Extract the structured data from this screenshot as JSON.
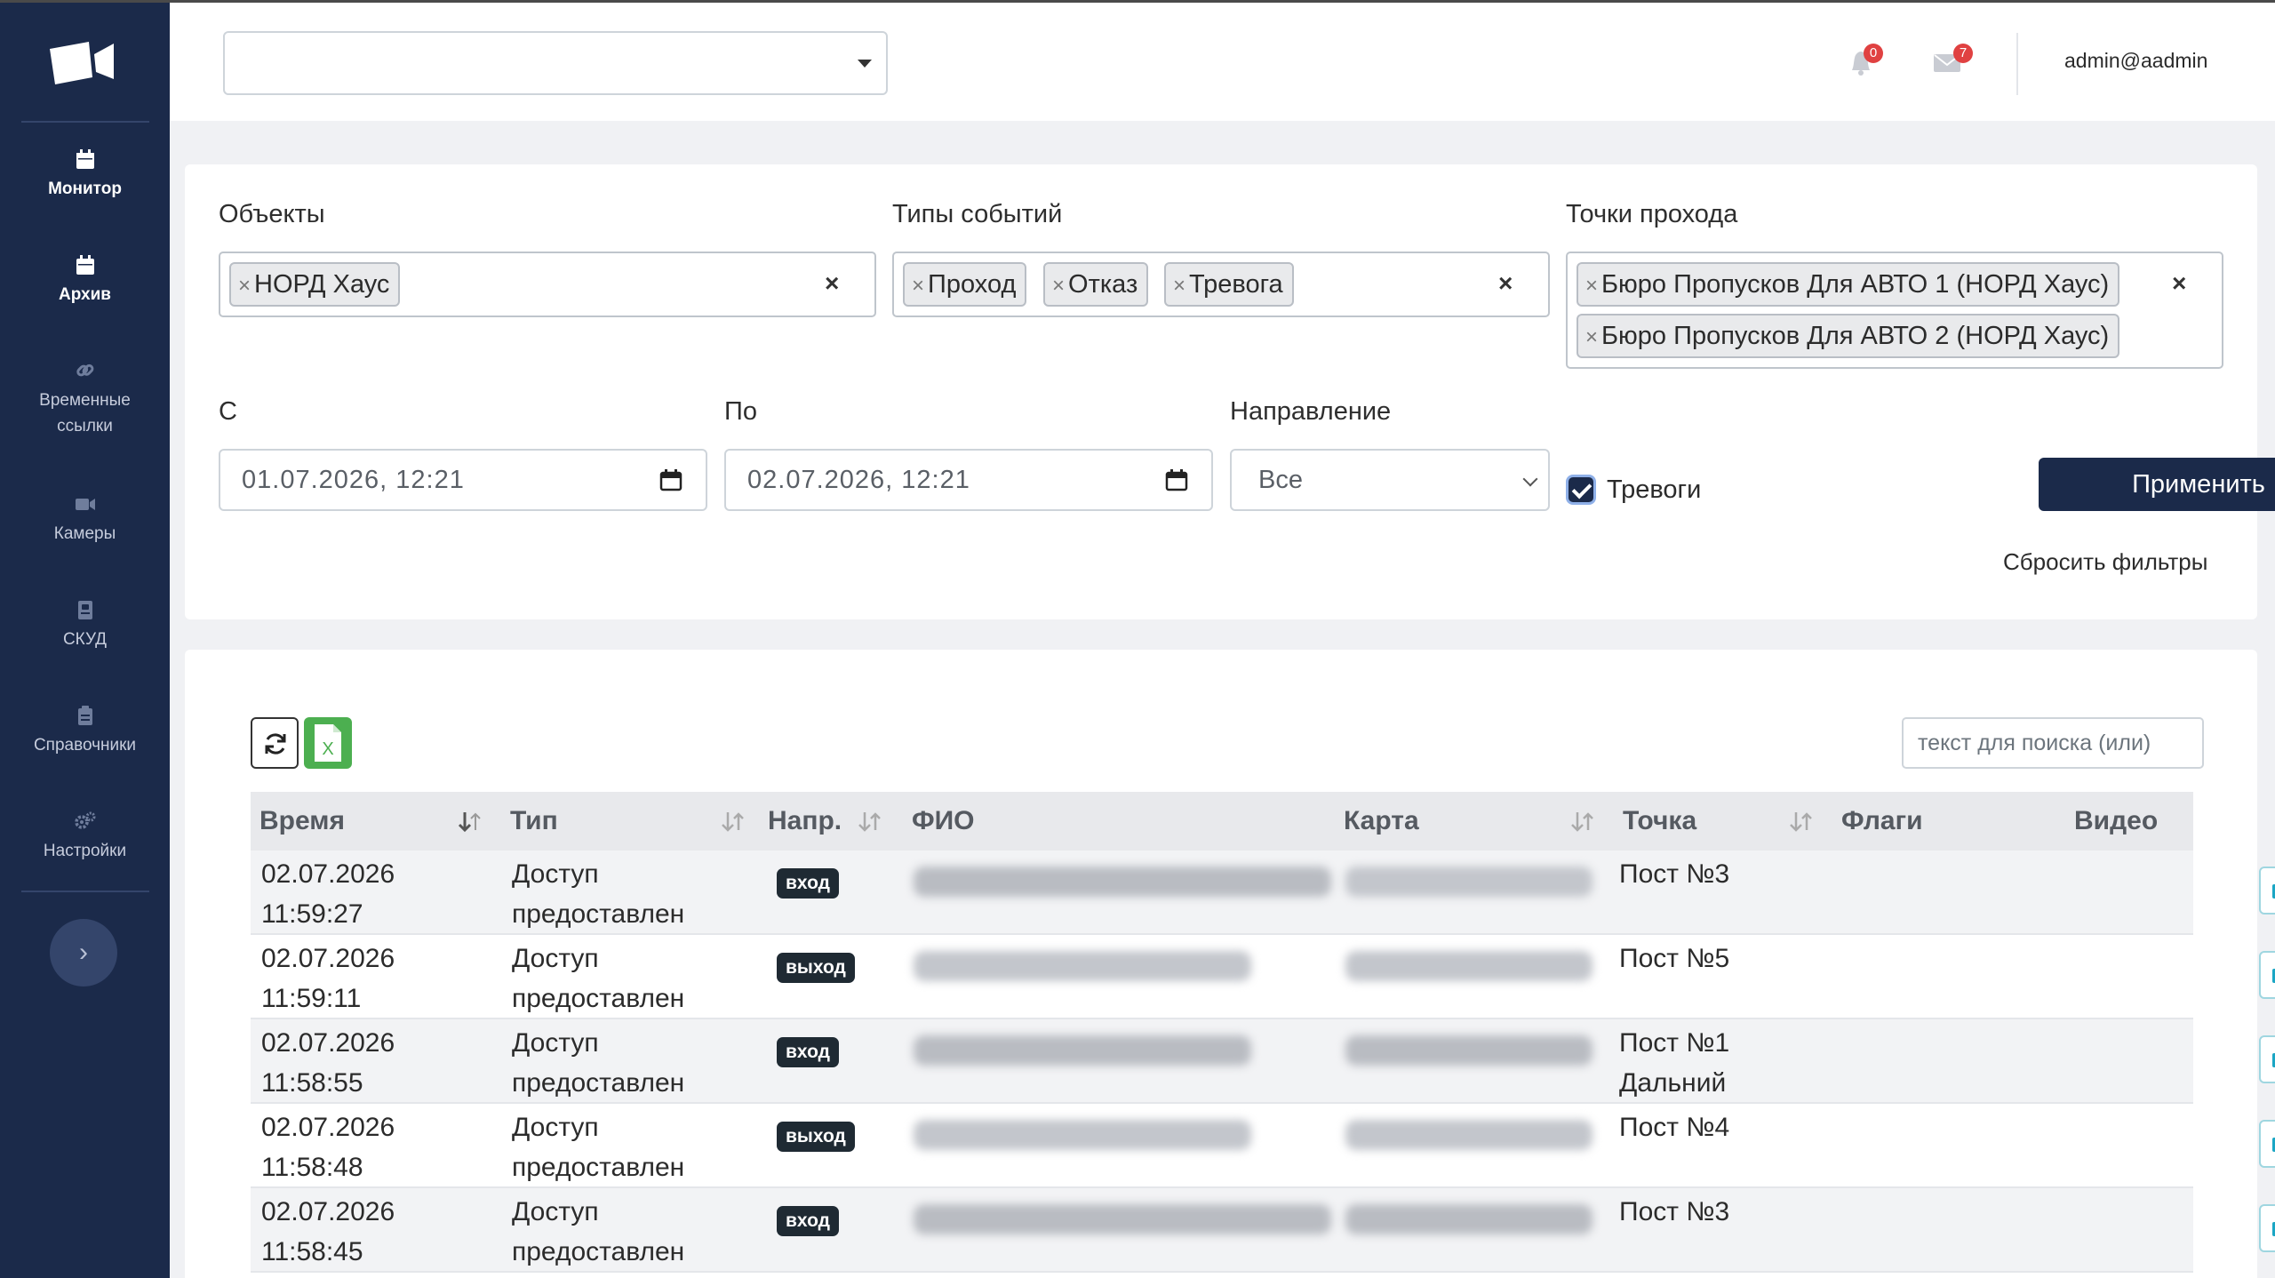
{
  "sidebar": {
    "items": [
      {
        "label": "Монитор",
        "icon": "calendar-icon",
        "active": true
      },
      {
        "label": "Архив",
        "icon": "calendar-icon",
        "active": false
      },
      {
        "label_line1": "Временные",
        "label_line2": "ссылки",
        "icon": "link-icon"
      },
      {
        "label": "Камеры",
        "icon": "video-camera-icon"
      },
      {
        "label": "СКУД",
        "icon": "id-card-icon"
      },
      {
        "label": "Справочники",
        "icon": "clipboard-icon"
      },
      {
        "label": "Настройки",
        "icon": "gears-icon"
      }
    ],
    "toggle_icon": "chevron-right-icon"
  },
  "header": {
    "org_select_value": "",
    "notifications_count": "0",
    "messages_count": "7",
    "user": "admin@aadmin"
  },
  "filters": {
    "objects_label": "Объекты",
    "objects_tags": [
      "НОРД Хаус"
    ],
    "event_types_label": "Типы событий",
    "event_types_tags": [
      "Проход",
      "Отказ",
      "Тревога"
    ],
    "points_label": "Точки прохода",
    "points_tags": [
      "Бюро Пропусков Для АВТО 1 (НОРД Хаус)",
      "Бюро Пропусков Для АВТО 2 (НОРД Хаус)"
    ],
    "tag_remove": "×",
    "clear": "×",
    "from_label": "С",
    "from_value": "01.07.2026, 12:21",
    "to_label": "По",
    "to_value": "02.07.2026, 12:21",
    "direction_label": "Направление",
    "direction_value": "Все",
    "alarms_label": "Тревоги",
    "alarms_checked": true,
    "apply_label": "Применить",
    "reset_label": "Сбросить фильтры"
  },
  "table": {
    "search_placeholder": "текст для поиска (или)",
    "columns": [
      "Время",
      "Тип",
      "Напр.",
      "ФИО",
      "Карта",
      "Точка",
      "Флаги",
      "Видео"
    ],
    "rows": [
      {
        "date": "02.07.2026",
        "time": "11:59:27",
        "type1": "Доступ",
        "type2": "предоставлен",
        "dir": "вход",
        "point1": "Пост №3",
        "point2": ""
      },
      {
        "date": "02.07.2026",
        "time": "11:59:11",
        "type1": "Доступ",
        "type2": "предоставлен",
        "dir": "выход",
        "point1": "Пост №5",
        "point2": ""
      },
      {
        "date": "02.07.2026",
        "time": "11:58:55",
        "type1": "Доступ",
        "type2": "предоставлен",
        "dir": "вход",
        "point1": "Пост №1",
        "point2": "Дальний"
      },
      {
        "date": "02.07.2026",
        "time": "11:58:48",
        "type1": "Доступ",
        "type2": "предоставлен",
        "dir": "выход",
        "point1": "Пост №4",
        "point2": ""
      },
      {
        "date": "02.07.2026",
        "time": "11:58:45",
        "type1": "Доступ",
        "type2": "предоставлен",
        "dir": "вход",
        "point1": "Пост №3",
        "point2": ""
      }
    ]
  },
  "colors": {
    "sidebar_bg": "#1b2a4a",
    "primary": "#1b2a4a",
    "badge_red": "#e04141",
    "excel_green": "#4caf50",
    "video_border": "#9fd6e0"
  }
}
